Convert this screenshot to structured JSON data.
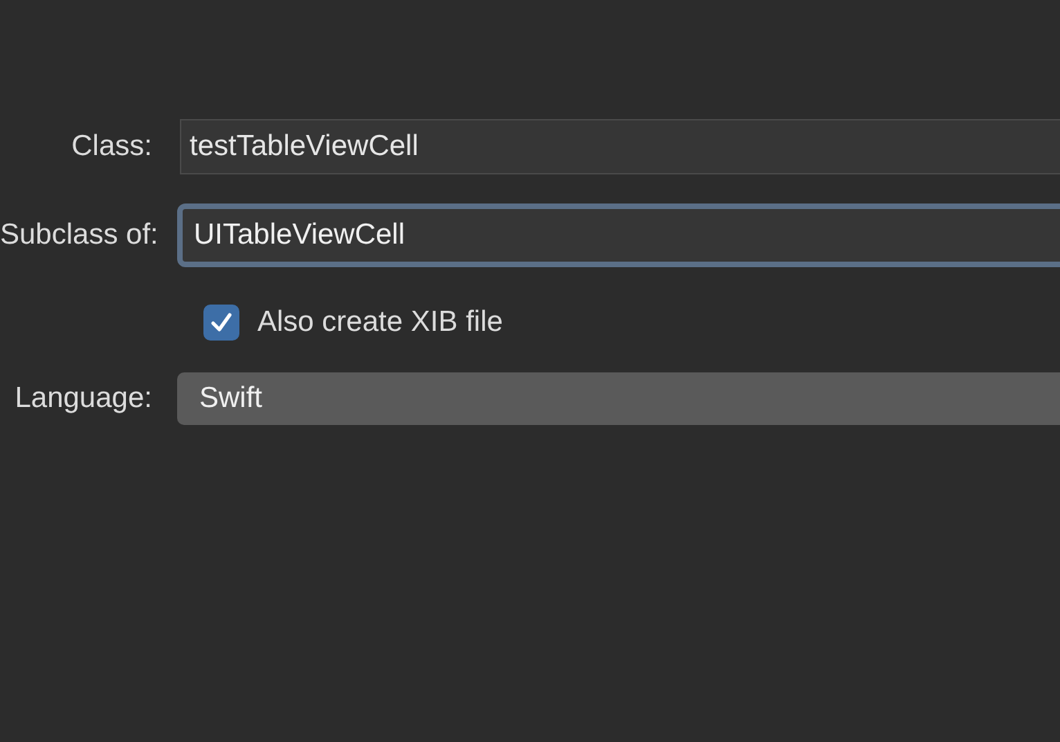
{
  "form": {
    "class": {
      "label": "Class:",
      "value": "testTableViewCell"
    },
    "subclass": {
      "label": "Subclass of:",
      "value": "UITableViewCell",
      "focused": true
    },
    "xib": {
      "label": "Also create XIB file",
      "checked": true
    },
    "language": {
      "label": "Language:",
      "value": "Swift"
    }
  }
}
